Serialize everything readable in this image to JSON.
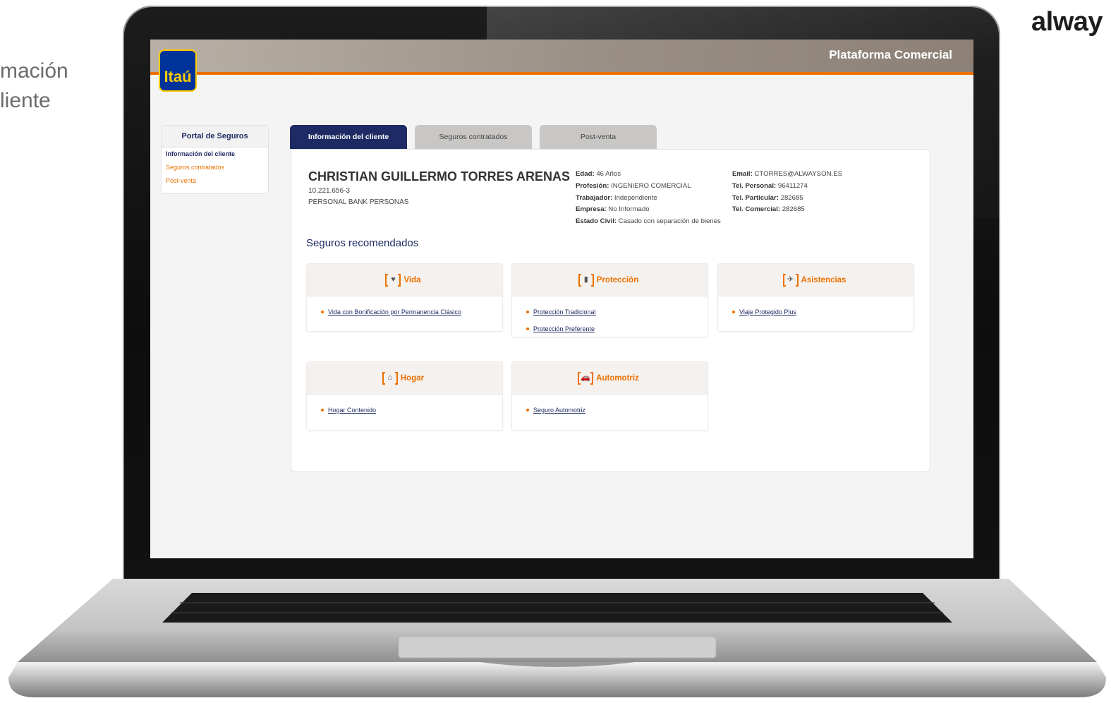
{
  "slide": {
    "caption": "mación\nliente",
    "brand_fragment": "alway"
  },
  "app": {
    "logo_text": "Itaú",
    "title": "Plataforma Comercial"
  },
  "sidebar": {
    "title": "Portal de Seguros",
    "items": [
      {
        "label": "Información del cliente"
      },
      {
        "label": "Seguros contratados"
      },
      {
        "label": "Post-venta"
      }
    ]
  },
  "tabs": [
    {
      "label": "Información del cliente"
    },
    {
      "label": "Seguros contratados"
    },
    {
      "label": "Post-venta"
    }
  ],
  "client": {
    "name": "CHRISTIAN GUILLERMO TORRES ARENAS",
    "rut": "10.221.656-3",
    "segment": "PERSONAL BANK PERSONAS",
    "details": [
      {
        "label": "Edad:",
        "value": "46 Años"
      },
      {
        "label": "Profesión:",
        "value": "INGENIERO COMERCIAL"
      },
      {
        "label": "Trabajador:",
        "value": "Independiente"
      },
      {
        "label": "Empresa:",
        "value": "No Informado"
      },
      {
        "label": "Estado Civil:",
        "value": "Casado con separación de bienes"
      }
    ],
    "contact": [
      {
        "label": "Email:",
        "value": "CTORRES@ALWAYSON.ES"
      },
      {
        "label": "Tel. Personal:",
        "value": "96411274"
      },
      {
        "label": "Tel. Particular:",
        "value": "282685"
      },
      {
        "label": "Tel. Comercial:",
        "value": "282685"
      }
    ]
  },
  "recommended": {
    "title": "Seguros recomendados",
    "cards": [
      {
        "title": "Vida",
        "icon": "heart-icon",
        "glyph": "♥",
        "items": [
          "Vida con Bonificación por Permanencia Clásico"
        ]
      },
      {
        "title": "Protección",
        "icon": "shield-icon",
        "glyph": "▮",
        "items": [
          "Protección Tradicional",
          "Protección Preferente"
        ]
      },
      {
        "title": "Asistencias",
        "icon": "airplane-icon",
        "glyph": "✈",
        "items": [
          "Viaje Protegido Plus"
        ]
      },
      {
        "title": "Hogar",
        "icon": "house-icon",
        "glyph": "⌂",
        "items": [
          "Hogar Contenido"
        ]
      },
      {
        "title": "Automotriz",
        "icon": "car-icon",
        "glyph": "🚗",
        "items": [
          "Seguro Automotriz"
        ]
      }
    ]
  },
  "colors": {
    "primary": "#1e2a63",
    "accent": "#ec7000",
    "logo_blue": "#003399",
    "logo_yellow": "#ffcc00"
  }
}
